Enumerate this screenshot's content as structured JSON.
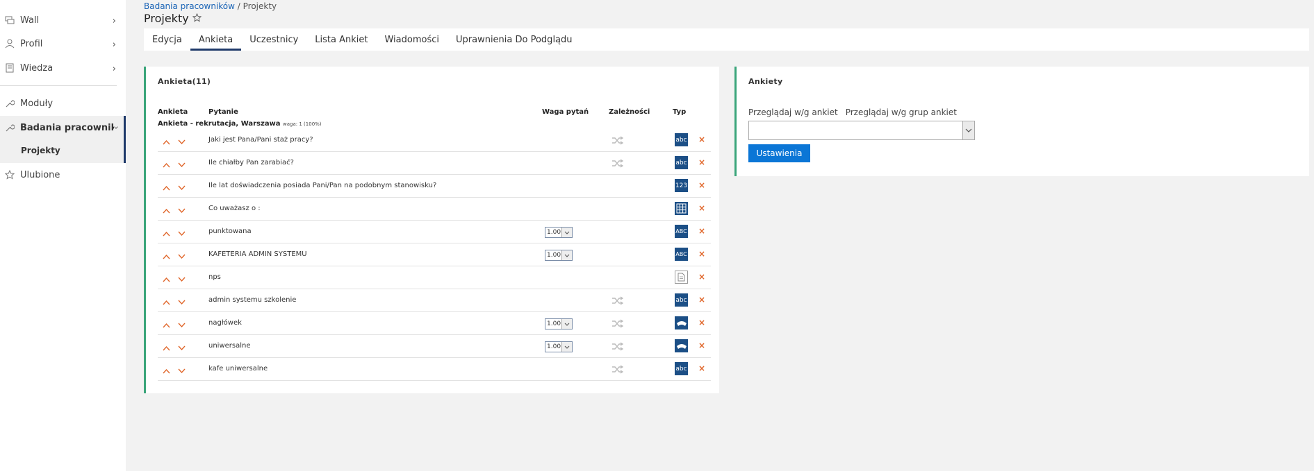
{
  "sidebar": {
    "items": [
      {
        "label": "Wall",
        "icon": "wall-icon"
      },
      {
        "label": "Profil",
        "icon": "user-icon"
      },
      {
        "label": "Wiedza",
        "icon": "book-icon"
      },
      {
        "label": "Moduły",
        "icon": "wrench-icon"
      },
      {
        "label": "Badania pracowników",
        "icon": "wrench-icon"
      },
      {
        "label": "Ulubione",
        "icon": "star-icon"
      }
    ],
    "sub_item": "Projekty"
  },
  "header": {
    "breadcrumb_link": "Badania pracowników",
    "breadcrumb_rest": " / Projekty",
    "title": "Projekty"
  },
  "tabs": [
    {
      "label": "Edycja"
    },
    {
      "label": "Ankieta",
      "active": true
    },
    {
      "label": "Uczestnicy"
    },
    {
      "label": "Lista Ankiet"
    },
    {
      "label": "Wiadomości"
    },
    {
      "label": "Uprawnienia Do Podglądu"
    }
  ],
  "survey_panel": {
    "title": "Ankieta(11)",
    "columns": {
      "survey": "Ankieta",
      "question": "Pytanie",
      "weight": "Waga pytań",
      "deps": "Zależności",
      "type": "Typ"
    },
    "group_title": "Ankieta - rekrutacja, Warszawa",
    "group_weight": "waga: 1 (100%)",
    "rows": [
      {
        "question": "Jaki jest Pana/Pani staż pracy?",
        "weight": "",
        "dep": true,
        "type": "abc"
      },
      {
        "question": "Ile chiałby Pan zarabiać?",
        "weight": "",
        "dep": true,
        "type": "abc"
      },
      {
        "question": "Ile lat doświadczenia posiada Pani/Pan na podobnym stanowisku?",
        "weight": "",
        "dep": false,
        "type": "123"
      },
      {
        "question": "Co uważasz o :",
        "weight": "",
        "dep": false,
        "type": "grid"
      },
      {
        "question": "punktowana",
        "weight": "1.00",
        "dep": false,
        "type": "ABC"
      },
      {
        "question": "KAFETERIA ADMIN SYSTEMU",
        "weight": "1.00",
        "dep": false,
        "type": "ABC"
      },
      {
        "question": "nps",
        "weight": "",
        "dep": false,
        "type": "doc"
      },
      {
        "question": "admin systemu szkolenie",
        "weight": "",
        "dep": true,
        "type": "abc"
      },
      {
        "question": "nagłówek",
        "weight": "1.00",
        "dep": true,
        "type": "arc"
      },
      {
        "question": "uniwersalne",
        "weight": "1.00",
        "dep": true,
        "type": "arc"
      },
      {
        "question": "kafe uniwersalne",
        "weight": "",
        "dep": true,
        "type": "abc"
      }
    ]
  },
  "surveys_panel": {
    "title": "Ankiety",
    "link_by_survey": "Przeglądaj w/g ankiet",
    "link_by_group": "Przeglądaj w/g grup ankiet",
    "select_value": "",
    "settings_label": "Ustawienia"
  },
  "colors": {
    "accent_dark": "#1f3a6a",
    "panel_border": "#3aa57a",
    "button": "#0b76d6",
    "arrow": "#e0662a",
    "type_icon": "#1c4f86"
  }
}
